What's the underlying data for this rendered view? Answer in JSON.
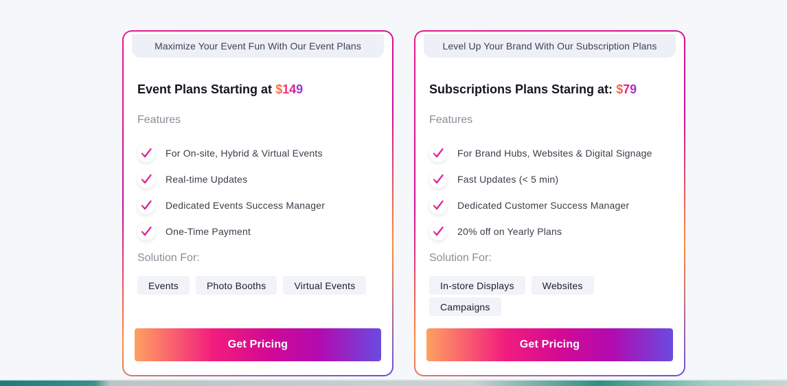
{
  "cards": [
    {
      "tagline": "Maximize Your Event Fun With Our Event Plans",
      "title": "Event Plans Starting at ",
      "price": "$149",
      "features_label": "Features",
      "features": [
        "For On-site, Hybrid & Virtual Events",
        "Real-time Updates",
        "Dedicated Events Success Manager",
        "One-Time Payment"
      ],
      "solution_label": "Solution For:",
      "solutions": [
        "Events",
        "Photo Booths",
        "Virtual Events"
      ],
      "cta": "Get Pricing"
    },
    {
      "tagline": "Level Up Your Brand With Our Subscription Plans",
      "title": "Subscriptions Plans Staring at: ",
      "price": "$79",
      "features_label": "Features",
      "features": [
        "For Brand Hubs, Websites & Digital Signage",
        "Fast Updates (< 5 min)",
        "Dedicated Customer Success Manager",
        "20% off on Yearly Plans"
      ],
      "solution_label": "Solution For:",
      "solutions": [
        "In-store Displays",
        "Websites",
        "Campaigns"
      ],
      "cta": "Get Pricing"
    }
  ],
  "icons": {
    "feature_bullet": "checkmark-icon"
  },
  "colors": {
    "accent_pink": "#f0147a",
    "accent_orange": "#ff8a3a",
    "accent_purple": "#6a4be0",
    "chip_bg": "#f1f3f8",
    "tagline_bg": "#eef0f7"
  }
}
